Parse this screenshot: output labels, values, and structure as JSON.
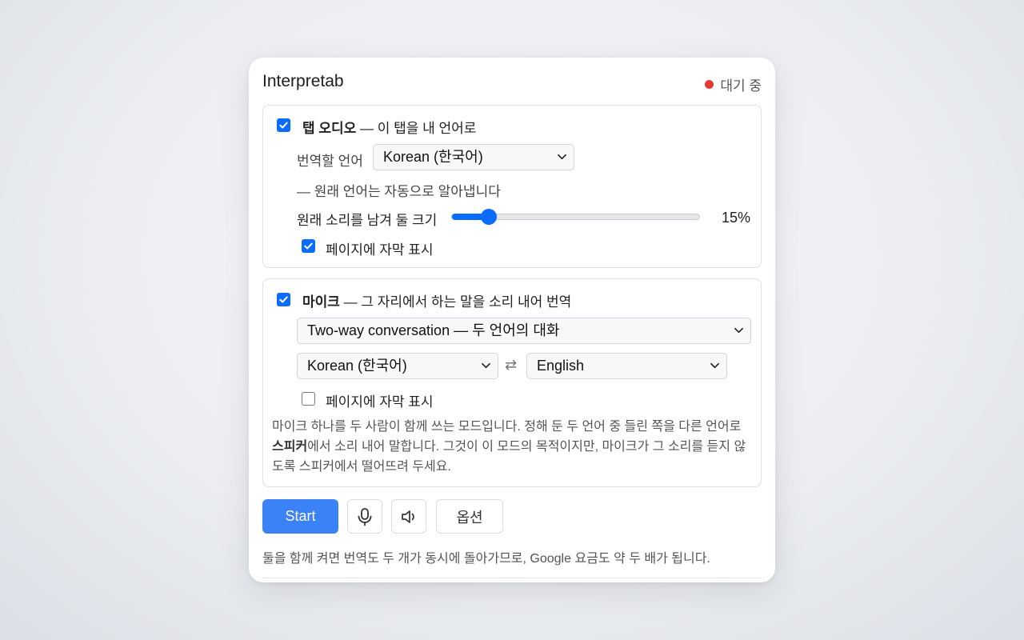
{
  "app": {
    "title": "Interpretab",
    "status_label": "대기 중",
    "status_color": "#e53935"
  },
  "tab_audio": {
    "enabled": true,
    "heading": "탭 오디오",
    "subtitle": "— 이 탭을 내 언어로",
    "target_label": "번역할 언어",
    "target_language": "Korean (한국어)",
    "auto_detect_note": "— 원래 언어는 자동으로 알아냅니다",
    "keep_original_label": "원래 소리를 남겨 둘 크기",
    "keep_original_value": 15,
    "keep_original_text": "15%",
    "subtitles_label": "페이지에 자막 표시",
    "subtitles_enabled": true
  },
  "microphone": {
    "enabled": true,
    "heading": "마이크",
    "subtitle": "— 그 자리에서 하는 말을 소리 내어 번역",
    "mode": "Two-way conversation — 두 언어의 대화",
    "language_a": "Korean (한국어)",
    "language_b": "English",
    "swap_symbol": "⇄",
    "subtitles_label": "페이지에 자막 표시",
    "subtitles_enabled": false,
    "note_part1": "마이크 하나를 두 사람이 함께 쓰는 모드입니다. 정해 둔 두 언어 중 들린 쪽을 다른 언어로 ",
    "note_bold": "스피커",
    "note_part2": "에서 소리 내어 말합니다. 그것이 이 모드의 목적이지만, 마이크가 그 소리를 듣지 않도록 스피커에서 떨어뜨려 두세요."
  },
  "actions": {
    "start_label": "Start",
    "mic_icon": "microphone-icon",
    "speaker_icon": "speaker-icon",
    "options_label": "옵션"
  },
  "footer": {
    "note": "둘을 함께 켜면 번역도 두 개가 동시에 돌아가므로, Google 요금도 약 두 배가 됩니다."
  },
  "colors": {
    "accent": "#0a6cff",
    "start_button": "#3b82f6"
  }
}
